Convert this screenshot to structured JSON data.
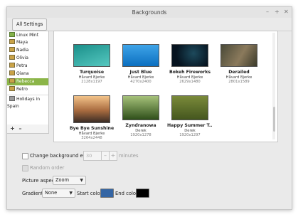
{
  "window": {
    "title": "Backgrounds",
    "controls": [
      "–",
      "+",
      "✕"
    ]
  },
  "toolbar": {
    "all_settings_label": "All Settings"
  },
  "sidebar": {
    "items": [
      {
        "label": "Linux Mint",
        "icon": "folder-mint-icon",
        "selected": false
      },
      {
        "label": "Maya",
        "icon": "folder-icon",
        "selected": false
      },
      {
        "label": "Nadia",
        "icon": "folder-icon",
        "selected": false
      },
      {
        "label": "Olivia",
        "icon": "folder-icon",
        "selected": false
      },
      {
        "label": "Petra",
        "icon": "folder-icon",
        "selected": false
      },
      {
        "label": "Qiana",
        "icon": "folder-icon",
        "selected": false
      },
      {
        "label": "Rebecca",
        "icon": "folder-icon",
        "selected": true
      },
      {
        "label": "Retro",
        "icon": "folder-icon",
        "selected": false
      },
      {
        "label": "Holidays in Spain",
        "icon": "picture-folder-icon",
        "selected": false
      }
    ],
    "add_label": "+",
    "remove_label": "–"
  },
  "wallpapers": [
    {
      "name": "Turquoise",
      "author": "Håvard Bjerke",
      "dims": "2128x1197",
      "colors": [
        "#1a8f8a",
        "#56c8c0"
      ]
    },
    {
      "name": "Just Blue",
      "author": "Håvard Bjerke",
      "dims": "4270x2400",
      "colors": [
        "#0b6fc0",
        "#3fa4e8"
      ]
    },
    {
      "name": "Bokeh Fireworks",
      "author": "Håvard Bjerke",
      "dims": "2629x1480",
      "colors": [
        "#06131f",
        "#1d4a5c"
      ]
    },
    {
      "name": "Derailed",
      "author": "Håvard Bjerke",
      "dims": "2801x1589",
      "colors": [
        "#4a4a38",
        "#8b7a5c"
      ]
    },
    {
      "name": "Bye Bye Sunshine",
      "author": "Håvard Bjerke",
      "dims": "3264x2448",
      "colors": [
        "#f4c48a",
        "#3a2c25"
      ]
    },
    {
      "name": "Zyndranowa",
      "author": "Derek",
      "dims": "1920x1278",
      "colors": [
        "#2f4f1a",
        "#a6c27a"
      ]
    },
    {
      "name": "Happy Summer T...",
      "author": "Derek",
      "dims": "1920x1297",
      "colors": [
        "#7a8a3a",
        "#44561e"
      ]
    }
  ],
  "options": {
    "change_bg_label": "Change background every",
    "interval_value": "30",
    "minus_label": "–",
    "plus_label": "+",
    "minutes_label": "minutes",
    "random_order_label": "Random order",
    "picture_aspect_label": "Picture aspect",
    "picture_aspect_value": "Zoom",
    "gradient_label": "Gradient",
    "gradient_value": "None",
    "start_color_label": "Start color",
    "start_color": "#3465a4",
    "end_color_label": "End color",
    "end_color": "#000000"
  }
}
